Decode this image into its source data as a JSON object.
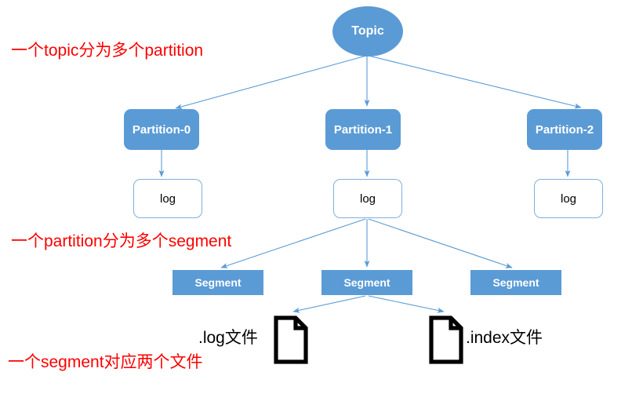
{
  "diagram": {
    "title": "Kafka Topic / Partition / Segment structure",
    "colors": {
      "node_fill": "#5B9BD5",
      "node_text": "#ffffff",
      "line": "#5B9BD5",
      "log_border": "#7FAFDD",
      "annotation": "#FF0000",
      "file_outline": "#000000",
      "background": "#ffffff"
    },
    "topic": {
      "label": "Topic"
    },
    "partitions": [
      {
        "label": "Partition-0"
      },
      {
        "label": "Partition-1"
      },
      {
        "label": "Partition-2"
      }
    ],
    "logs": [
      {
        "label": "log"
      },
      {
        "label": "log"
      },
      {
        "label": "log"
      }
    ],
    "segments": [
      {
        "label": "Segment"
      },
      {
        "label": "Segment"
      },
      {
        "label": "Segment"
      }
    ],
    "files": [
      {
        "label": ".log文件",
        "icon": "document-icon"
      },
      {
        "label": ".index文件",
        "icon": "document-icon"
      }
    ],
    "annotations": [
      {
        "text": "一个topic分为多个partition"
      },
      {
        "text": "一个partition分为多个segment"
      },
      {
        "text": "一个segment对应两个文件"
      }
    ]
  }
}
